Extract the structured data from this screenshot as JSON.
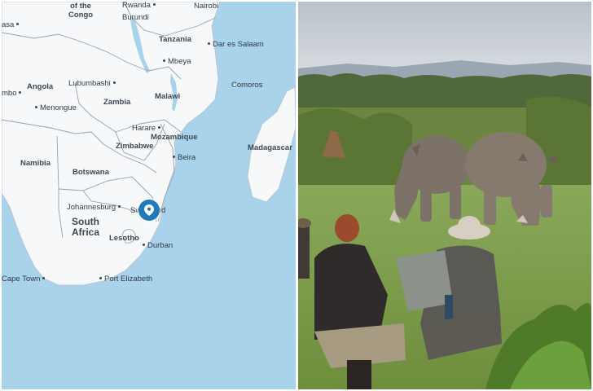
{
  "map": {
    "water_color": "#a9d3ea",
    "land_color": "#f7f8f9",
    "border_color": "#9aa3ab",
    "pin_color": "#1e7ab8",
    "labels": {
      "of_the_congo": "of the\nCongo",
      "rwanda": "Rwanda",
      "nairobi": "Nairobi",
      "burundi": "Burundi",
      "kinshasa_partial": "asa",
      "tanzania": "Tanzania",
      "dar_es_salaam": "Dar es Salaam",
      "mbeya": "Mbeya",
      "lubumbashi": "Lubumbashi",
      "angola": "Angola",
      "lubango_partial": "mbo",
      "malawi": "Malawi",
      "zambia": "Zambia",
      "comoros": "Comoros",
      "menongue": "Menongue",
      "harare": "Harare",
      "mozambique": "Mozambique",
      "zimbabwe": "Zimbabwe",
      "beira": "Beira",
      "madagascar": "Madagascar",
      "namibia": "Namibia",
      "botswana": "Botswana",
      "johannesburg": "Johannesburg",
      "swaziland": "Swaziland",
      "south_africa": "South\nAfrica",
      "lesotho": "Lesotho",
      "durban": "Durban",
      "cape_town": "Cape Town",
      "port_elizabeth": "Port Elizabeth"
    }
  },
  "photo": {
    "sky_color": "#c9cfd6",
    "grass_color": "#7f9e4a",
    "rhino_color": "#7d7268"
  }
}
